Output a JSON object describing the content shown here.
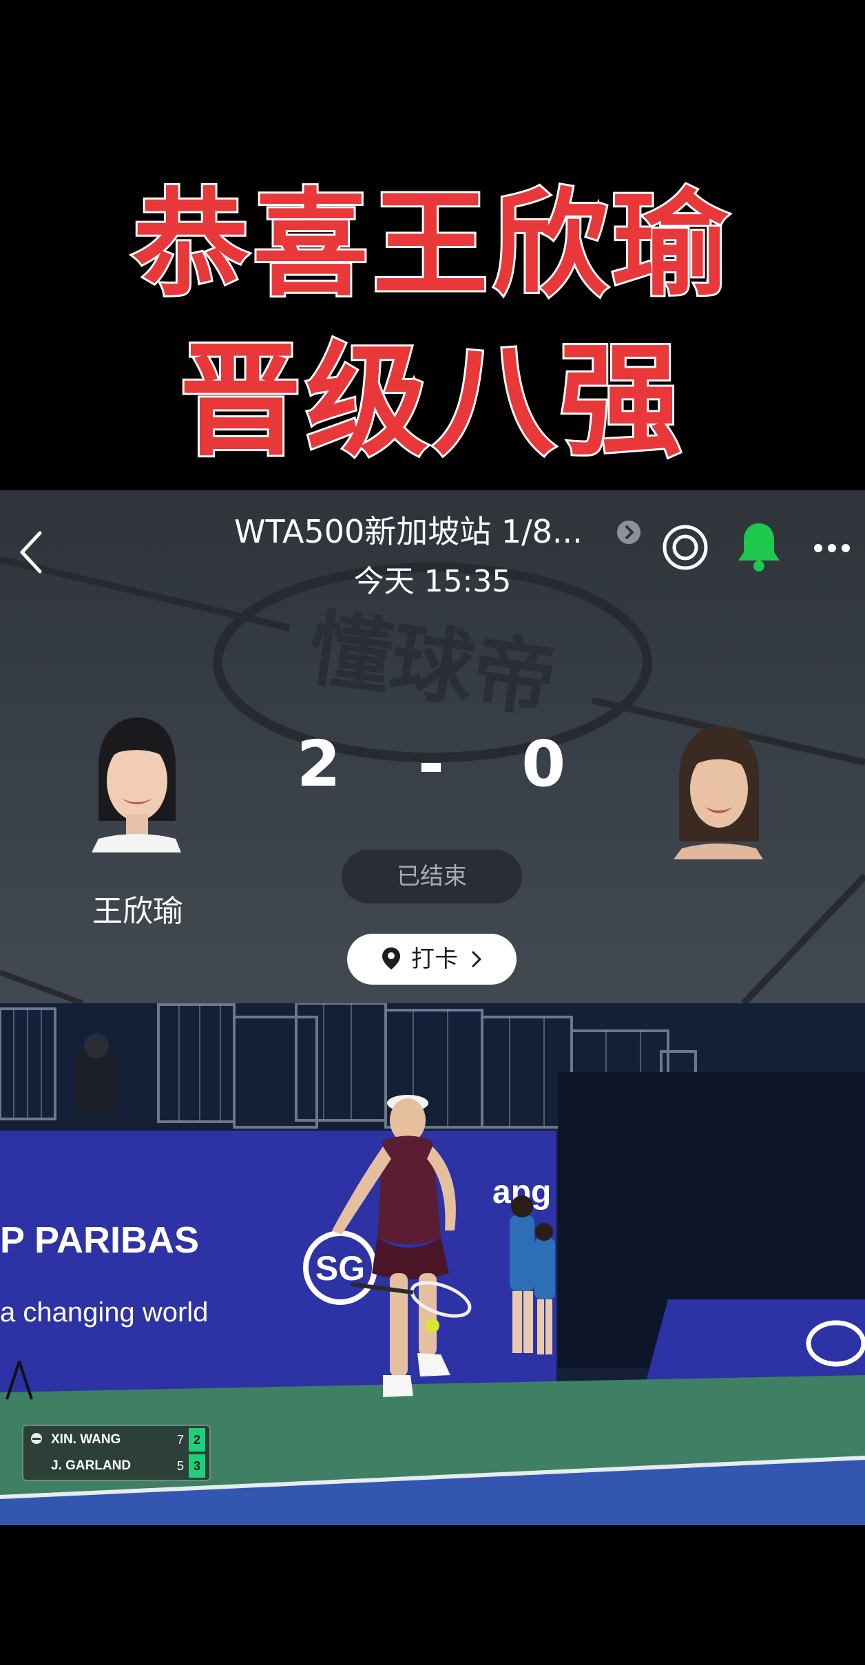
{
  "banner": {
    "line1": "恭喜王欣瑜",
    "line2": "晋级八强"
  },
  "header": {
    "title": "WTA500新加坡站 1/8...",
    "time": "今天 15:35",
    "watermark": "懂球帝"
  },
  "match": {
    "home_player": "王欣瑜",
    "away_player": "",
    "home_score": "2",
    "separator": "-",
    "away_score": "0",
    "status": "已结束",
    "checkin_label": "打卡"
  },
  "video": {
    "sponsor_text1": "P PARIBAS",
    "sponsor_text2": "a changing world",
    "sponsor_apg": "apg",
    "sg_logo": "SG",
    "scorebug": {
      "rows": [
        {
          "name": "XIN. WANG",
          "set1": "7",
          "set2": "2"
        },
        {
          "name": "J. GARLAND",
          "set1": "5",
          "set2": "3"
        }
      ]
    }
  },
  "colors": {
    "banner_red": "#e8383a",
    "bell_green": "#1ec84c",
    "scorebug_accent": "#1fcf7a"
  },
  "icons": [
    "back-arrow-icon",
    "chevron-right-icon",
    "target-icon",
    "bell-icon",
    "more-icon",
    "location-pin-icon"
  ]
}
